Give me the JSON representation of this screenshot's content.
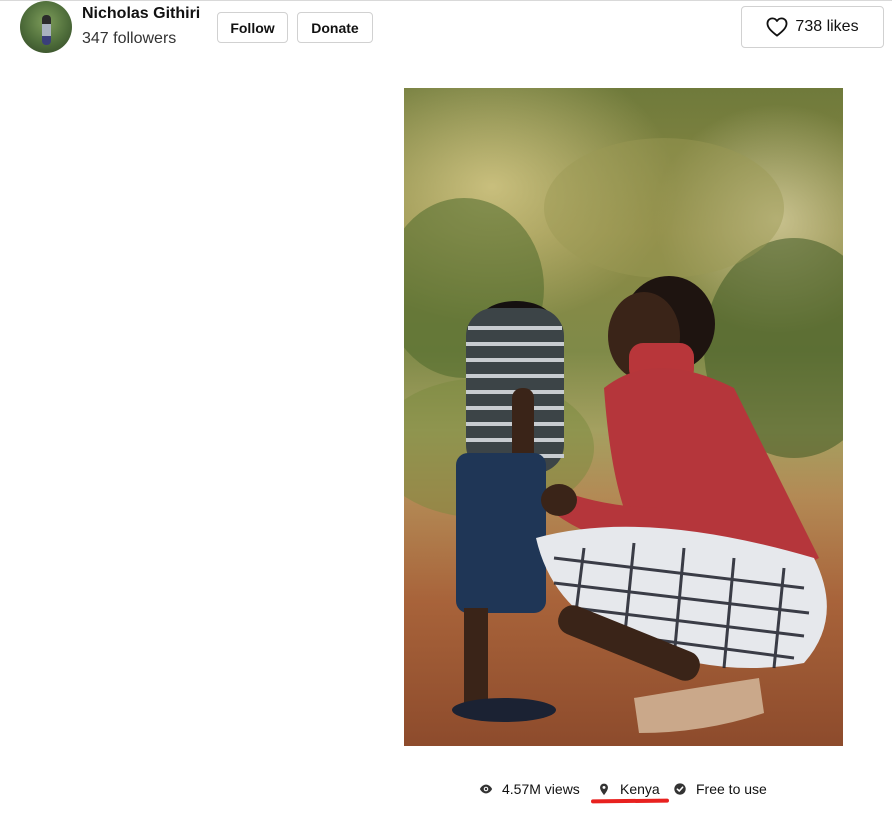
{
  "author": {
    "name": "Nicholas Githiri",
    "followers": "347 followers"
  },
  "actions": {
    "follow_label": "Follow",
    "donate_label": "Donate",
    "likes_label": "738 likes"
  },
  "photo": {
    "views": "4.57M views",
    "location": "Kenya",
    "license": "Free to use"
  },
  "icons": {
    "likes": "heart-icon",
    "views": "eye-icon",
    "location": "map-pin-icon",
    "license": "check-circle-icon"
  },
  "colors": {
    "annotation_underline": "#e8211f",
    "button_border": "#d1d1d1",
    "text": "#111111"
  }
}
